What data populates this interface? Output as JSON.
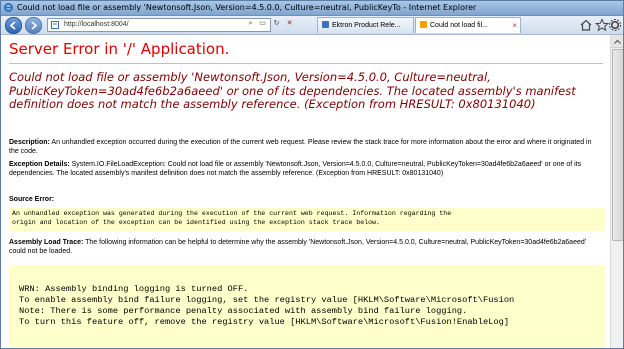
{
  "window": {
    "title": "Could not load file or assembly 'Newtonsoft.Json, Version=4.5.0.0, Culture=neutral, PublicKeyTo - Internet Explorer"
  },
  "navbar": {
    "address": "http://localhost:8004/",
    "tabs": [
      {
        "label": "Ektron Product Rele...",
        "icon": "ektron-icon"
      },
      {
        "label": "Could not load fil...",
        "icon": "error-page-icon"
      }
    ]
  },
  "page": {
    "title": "Server Error in '/' Application.",
    "error_message": "Could not load file or assembly 'Newtonsoft.Json, Version=4.5.0.0, Culture=neutral, PublicKeyToken=30ad4fe6b2a6aeed' or one of its dependencies. The located assembly's manifest definition does not match the assembly reference. (Exception from HRESULT: 0x80131040)",
    "description_label": "Description:",
    "description_text": " An unhandled exception occurred during the execution of the current web request. Please review the stack trace for more information about the error and where it originated in the code.",
    "exception_label": "Exception Details:",
    "exception_text": " System.IO.FileLoadException: Could not load file or assembly 'Newtonsoft.Json, Version=4.5.0.0, Culture=neutral, PublicKeyToken=30ad4fe6b2a6aeed' or one of its dependencies. The located assembly's manifest definition does not match the assembly reference. (Exception from HRESULT: 0x80131040)",
    "source_error_label": "Source Error:",
    "source_error_lines": [
      "An unhandled exception was generated during the execution of the current web request. Information regarding the",
      "origin and location of the exception can be identified using the exception stack trace below."
    ],
    "trace_label": "Assembly Load Trace:",
    "trace_text": " The following information can be helpful to determine why the assembly 'Newtonsoft.Json, Version=4.5.0.0, Culture=neutral, PublicKeyToken=30ad4fe6b2a6aeed' could not be loaded.",
    "trace_lines": [
      "WRN: Assembly binding logging is turned OFF.",
      "To enable assembly bind failure logging, set the registry value [HKLM\\Software\\Microsoft\\Fusion",
      "Note: There is some performance penalty associated with assembly bind failure logging.",
      "To turn this feature off, remove the registry value [HKLM\\Software\\Microsoft\\Fusion!EnableLog]"
    ]
  },
  "colors": {
    "title_red": "#e00000",
    "message_maroon": "#800000",
    "code_background": "#ffffcc"
  }
}
